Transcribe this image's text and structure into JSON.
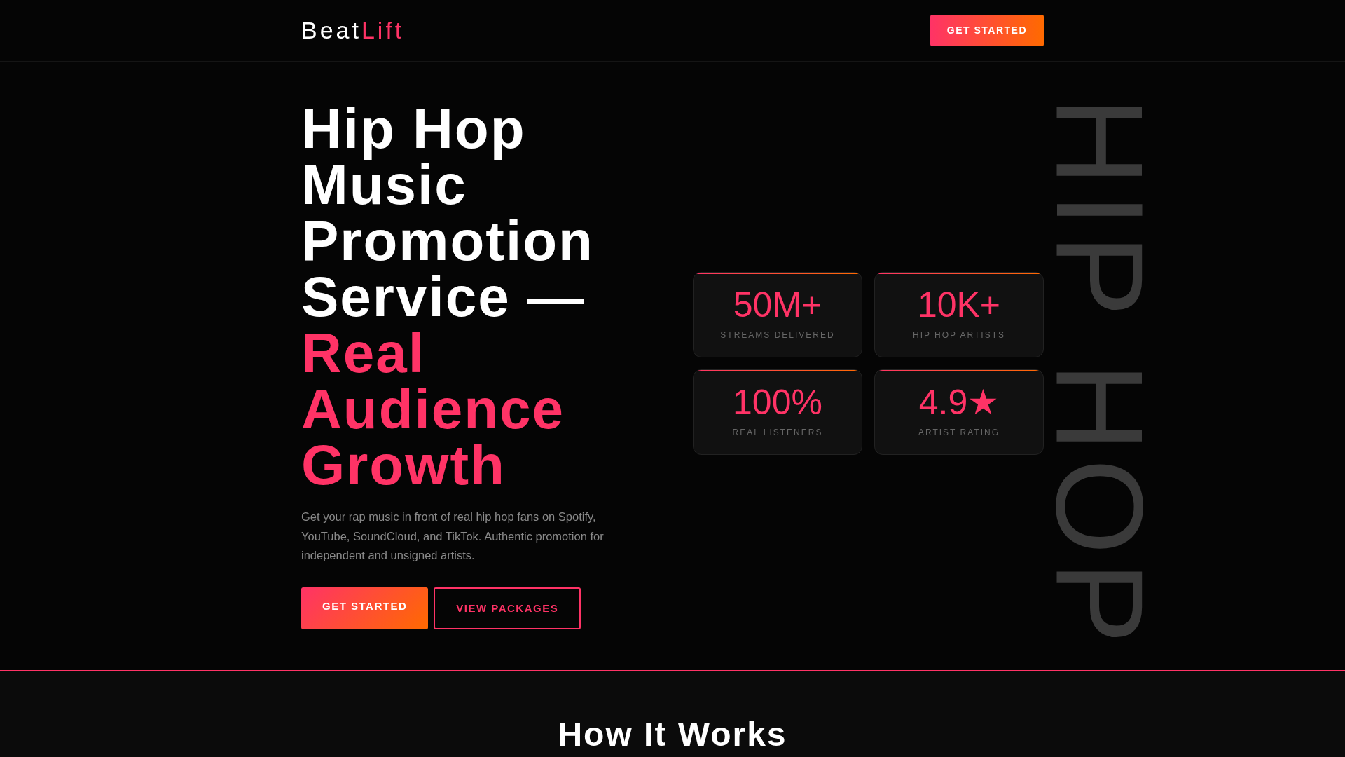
{
  "nav": {
    "logo": {
      "first": "Beat",
      "second": "Lift"
    },
    "cta": "GET STARTED"
  },
  "hero": {
    "heading": {
      "text": "Hip Hop Music Promotion Service —",
      "highlight": "Real Audience Growth"
    },
    "description": "Get your rap music in front of real hip hop fans on Spotify, YouTube, SoundCloud, and TikTok. Authentic promotion for independent and unsigned artists.",
    "buttons": [
      {
        "label": "GET STARTED",
        "kind": "primary"
      },
      {
        "label": "VIEW PACKAGES",
        "kind": "outline"
      }
    ],
    "stats": [
      {
        "value": "50M+",
        "label": "STREAMS DELIVERED"
      },
      {
        "value": "10K+",
        "label": "HIP HOP ARTISTS"
      },
      {
        "value": "100%",
        "label": "REAL LISTENERS"
      },
      {
        "value": "4.9★",
        "label": "ARTIST RATING"
      }
    ],
    "background_text": "HIP HOP"
  },
  "next_section": {
    "title": "How It Works"
  }
}
